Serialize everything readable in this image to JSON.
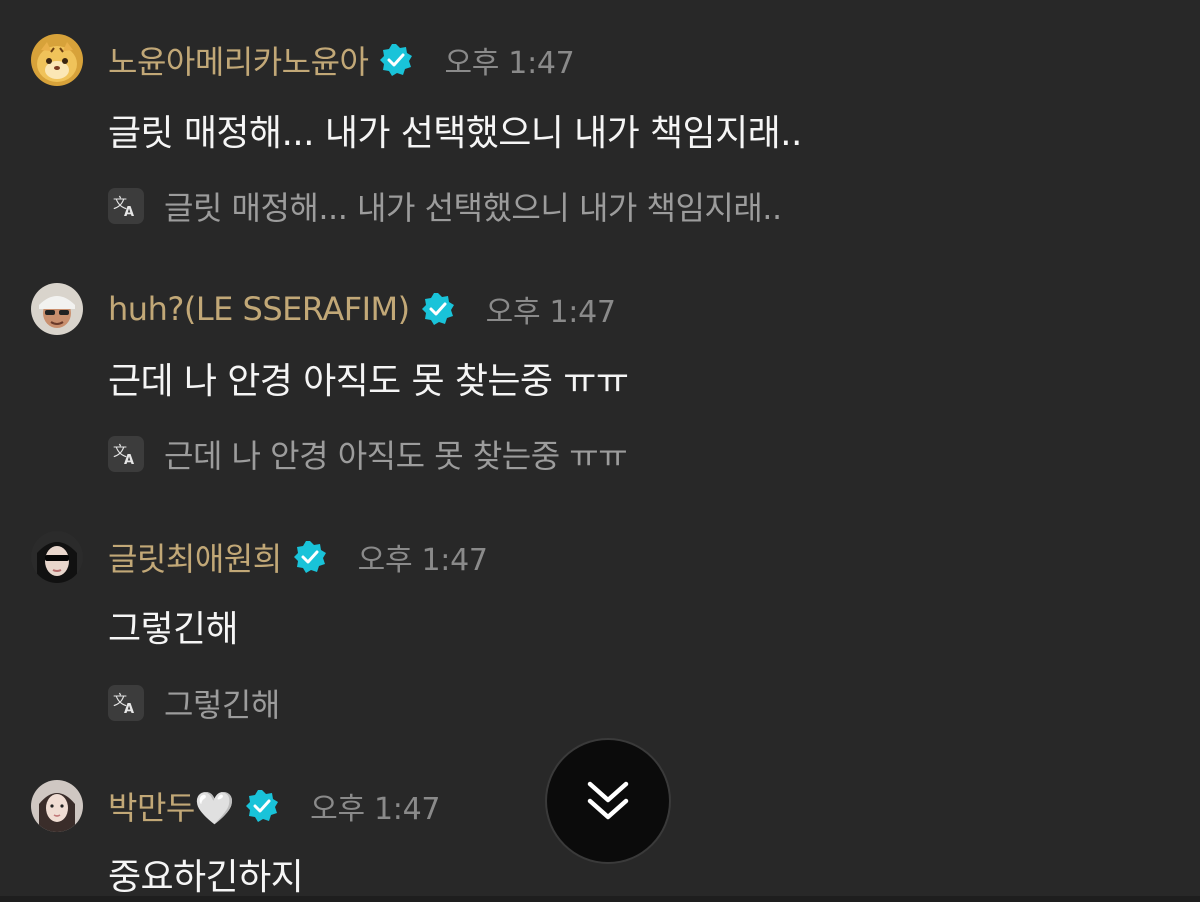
{
  "messages": [
    {
      "username": "노윤아메리카노윤아",
      "timestamp": "오후 1:47",
      "text": "글릿 매정해... 내가 선택했으니 내가 책임지래..",
      "translation": "글릿 매정해... 내가 선택했으니 내가 책임지래..",
      "avatar_icon": "tiger-cartoon-avatar"
    },
    {
      "username": "huh?(LE SSERAFIM)",
      "timestamp": "오후 1:47",
      "text": "근데 나 안경 아직도 못 찾는중 ㅠㅠ",
      "translation": "근데 나 안경 아직도 못 찾는중 ㅠㅠ",
      "avatar_icon": "person-with-hat-avatar"
    },
    {
      "username": "글릿최애원희",
      "timestamp": "오후 1:47",
      "text": "그렇긴해",
      "translation": "그렇긴해",
      "avatar_icon": "person-with-sunglasses-avatar"
    },
    {
      "username": "박만두🤍",
      "timestamp": "오후 1:47",
      "text": "중요하긴하지",
      "translation": "",
      "avatar_icon": "long-hair-person-avatar"
    }
  ],
  "colors": {
    "background": "#282828",
    "username": "#c2a877",
    "timestamp": "#8a8a8a",
    "message_text": "#f5f5f5",
    "translation_text": "#9c9c9c",
    "verified_badge": "#19c3d9"
  },
  "icons": {
    "verified": "verified-badge-icon",
    "translate": "translate-icon",
    "scroll_down": "double-chevron-down-icon"
  }
}
